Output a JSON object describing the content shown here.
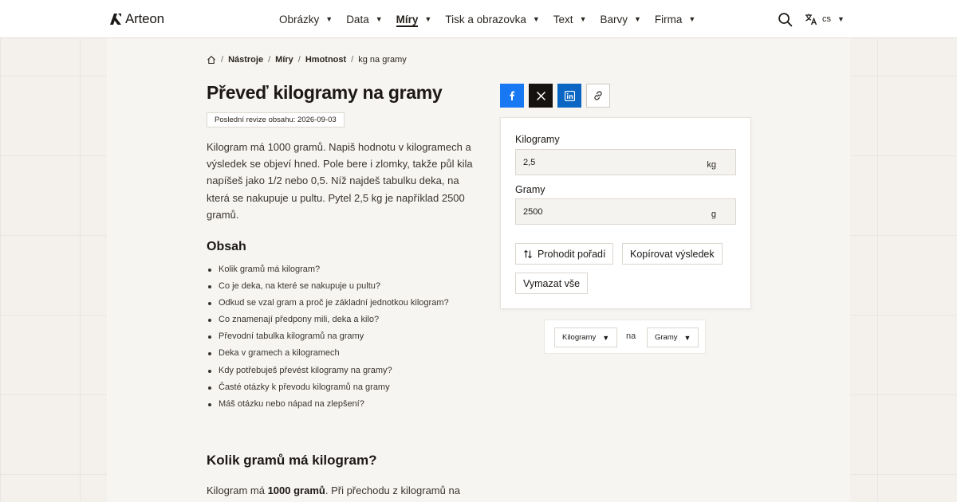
{
  "nav": {
    "logo_text": "Arteon",
    "menu": [
      {
        "label": "Obrázky"
      },
      {
        "label": "Data"
      },
      {
        "label": "Míry",
        "active": true
      },
      {
        "label": "Tisk a obrazovka"
      },
      {
        "label": "Text"
      },
      {
        "label": "Barvy"
      },
      {
        "label": "Firma"
      }
    ],
    "caret": "▼",
    "lang_code": "cs"
  },
  "breadcrumb": {
    "sep": "/",
    "items": [
      "Nástroje",
      "Míry",
      "Hmotnost"
    ],
    "current": "kg na gramy"
  },
  "page": {
    "title": "Převeď kilogramy na gramy",
    "revision": "Poslední revize obsahu: 2026-09-03",
    "intro": "Kilogram má 1000 gramů. Napiš hodnotu v kilogramech a výsledek se objeví hned. Pole bere i zlomky, takže půl kila napíšeš jako 1/2 nebo 0,5. Níž najdeš tabulku deka, na která se nakupuje u pultu. Pytel 2,5 kg je například 2500 gramů.",
    "toc_title": "Obsah",
    "toc": [
      "Kolik gramů má kilogram?",
      "Co je deka, na které se nakupuje u pultu?",
      "Odkud se vzal gram a proč je základní jednotkou kilogram?",
      "Co znamenají předpony mili, deka a kilo?",
      "Převodní tabulka kilogramů na gramy",
      "Deka v gramech a kilogramech",
      "Kdy potřebuješ převést kilogramy na gramy?",
      "Časté otázky k převodu kilogramů na gramy",
      "Máš otázku nebo nápad na zlepšení?"
    ],
    "section_title": "Kolik gramů má kilogram?",
    "section_text_pre": "Kilogram má ",
    "section_text_bold": "1000 gramů",
    "section_text_post": ". Při přechodu z kilogramů na"
  },
  "converter": {
    "from_label": "Kilogramy",
    "from_value": "2,5",
    "from_unit": "kg",
    "to_label": "Gramy",
    "to_value": "2500",
    "to_unit": "g",
    "swap_label": "Prohodit pořadí",
    "copy_label": "Kopírovat výsledek",
    "clear_label": "Vymazat vše"
  },
  "selector": {
    "from": "Kilogramy",
    "na": "na",
    "to": "Gramy"
  },
  "colors": {
    "facebook": "#1877f2",
    "x": "#15120f",
    "linkedin": "#0a66c2",
    "page_bg": "#f4f1ed",
    "panel_bg": "#f7f5f2"
  },
  "icons": [
    "logo-mark-icon",
    "search-icon",
    "translate-icon",
    "home-icon",
    "facebook-icon",
    "x-icon",
    "linkedin-icon",
    "link-icon",
    "swap-icon"
  ]
}
